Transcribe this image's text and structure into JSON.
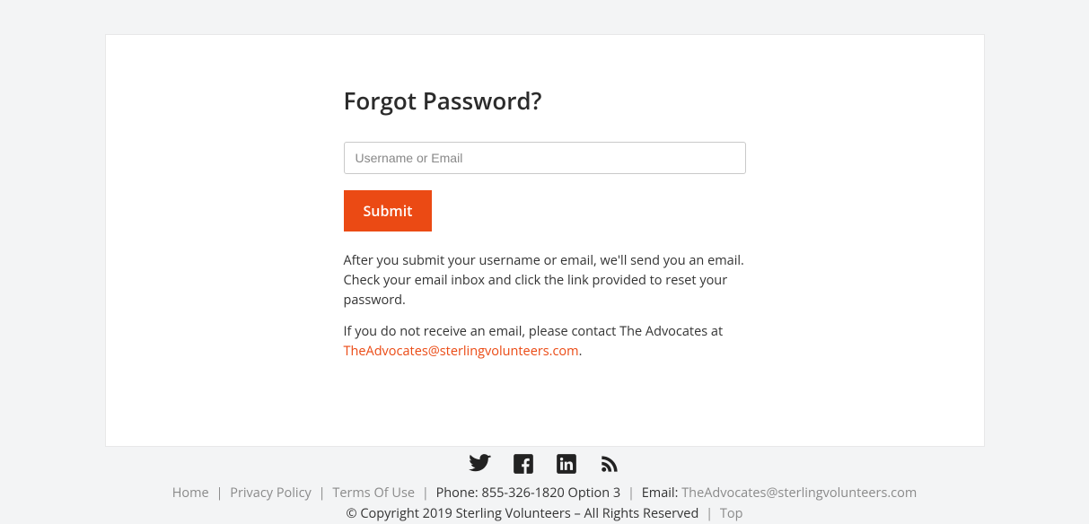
{
  "main": {
    "title": "Forgot Password?",
    "placeholder": "Username or Email",
    "submit_label": "Submit",
    "info1": "After you submit your username or email, we'll send you an email. Check your email inbox and click the link provided to reset your password.",
    "info2_prefix": "If you do not receive an email, please contact The Advocates at ",
    "info2_email": "TheAdvocates@sterlingvolunteers.com",
    "info2_suffix": "."
  },
  "footer": {
    "links": {
      "home": "Home",
      "privacy": "Privacy Policy",
      "terms": "Terms Of Use",
      "top": "Top"
    },
    "phone_label": "Phone:",
    "phone_value": "855-326-1820 Option 3",
    "email_label": "Email:",
    "email_value": "TheAdvocates@sterlingvolunteers.com",
    "copyright": "© Copyright 2019 Sterling Volunteers – All Rights Reserved"
  }
}
